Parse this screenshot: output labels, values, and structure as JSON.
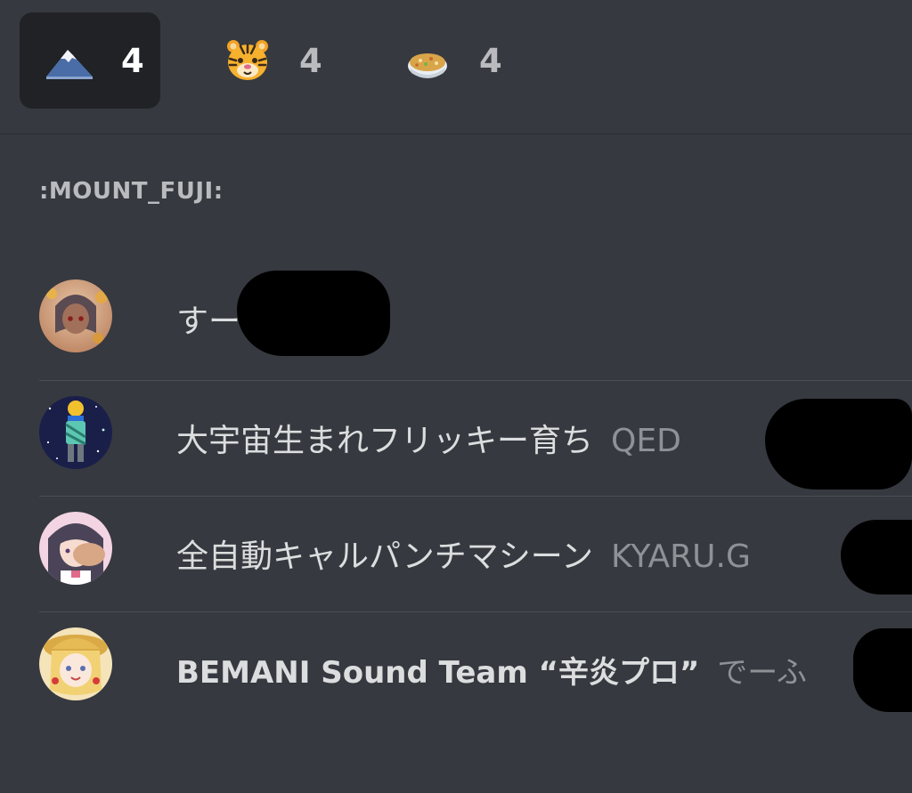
{
  "reaction_tabs": [
    {
      "emoji": "mount-fuji",
      "count": "4",
      "active": true
    },
    {
      "emoji": "tiger-face",
      "count": "4",
      "active": false
    },
    {
      "emoji": "fried-rice",
      "count": "4",
      "active": false
    }
  ],
  "section": {
    "title": ":MOUNT_FUJI:"
  },
  "users": [
    {
      "name": "すー",
      "tag": ""
    },
    {
      "name": "大宇宙生まれフリッキー育ち",
      "tag": "QED"
    },
    {
      "name": "全自動キャルパンチマシーン",
      "tag": "KYARU.G"
    },
    {
      "name": "BEMANI Sound Team “辛炎プロ”",
      "tag": "でーふ"
    }
  ],
  "colors": {
    "background": "#36393f",
    "active_tab": "#202225",
    "name_text": "#dcddde",
    "tag_text": "#8e9297",
    "section_text": "#b9bbbe"
  }
}
